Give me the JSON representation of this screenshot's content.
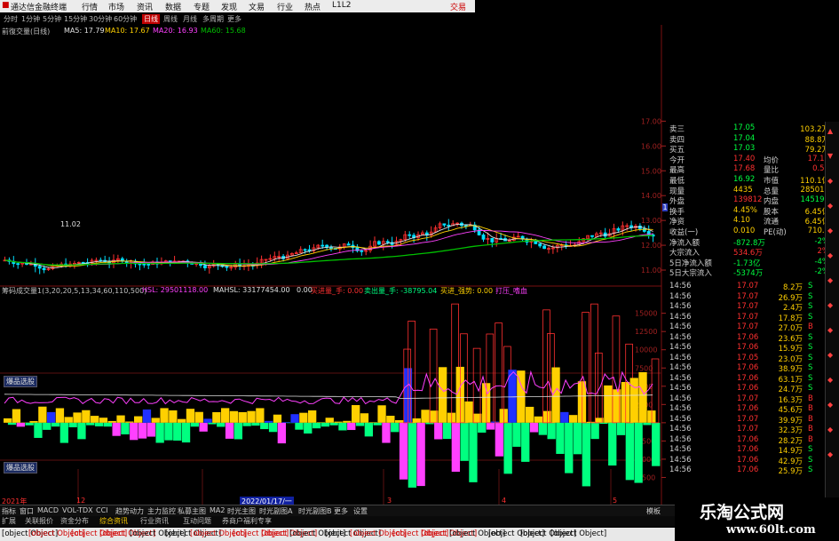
{
  "titlebar": {
    "app_title": "通达信金融终端",
    "menu": [
      "行情",
      "市场",
      "资讯",
      "数据",
      "专题",
      "发现",
      "文易",
      "行业",
      "热点",
      "L1L2"
    ],
    "trade": "交易"
  },
  "timeframes": {
    "items": [
      "分时",
      "1分钟",
      "5分钟",
      "15分钟",
      "30分钟",
      "60分钟",
      "日线",
      "周线",
      "月线",
      "多周期",
      "更多"
    ],
    "active_index": 6
  },
  "ma_legend": {
    "name": "前復交量(日线)",
    "items": [
      {
        "label": "MA5: 17.79",
        "color": "#e0e0e0"
      },
      {
        "label": "MA10: 17.67",
        "color": "#ffd000"
      },
      {
        "label": "MA20: 16.93",
        "color": "#ff40ff"
      },
      {
        "label": "MA60: 15.68",
        "color": "#00c000"
      }
    ]
  },
  "price_annotation": "11.02",
  "current_price_tag": "13.56",
  "indicator_legend": {
    "name": "筹码成交量1(3,20,20,5,13,34,60,110,500)",
    "items": [
      {
        "label": "HSL: 29501118.00",
        "color": "#ff40ff"
      },
      {
        "label": "MAHSL: 33177454.00",
        "color": "#e0e0e0"
      },
      {
        "label": "0.00",
        "color": "#e0e0e0"
      },
      {
        "label": "买进量_手: 0.00",
        "color": "#ff3030"
      },
      {
        "label": "卖出量_手: -38795.04",
        "color": "#00ff80"
      },
      {
        "label": "买进_强势: 0.00",
        "color": "#ffd000"
      },
      {
        "label": "打压_嗜血",
        "color": "#ff40ff"
      }
    ]
  },
  "side_labels": [
    "爆品选股",
    "爆品选股"
  ],
  "date_labels": [
    "2021年",
    "12",
    "2022/01/17/一",
    "3",
    "4",
    "5"
  ],
  "price_axis": {
    "ticks": [
      {
        "v": 17.0,
        "label": "17.00"
      },
      {
        "v": 16.0,
        "label": "16.00"
      },
      {
        "v": 15.0,
        "label": "15.00"
      },
      {
        "v": 14.0,
        "label": "14.00"
      },
      {
        "v": 13.0,
        "label": "13.00"
      },
      {
        "v": 12.0,
        "label": "12.00"
      },
      {
        "v": 11.0,
        "label": "11.00"
      }
    ]
  },
  "vol_axis": {
    "ticks": [
      {
        "v": 15000,
        "label": "15000"
      },
      {
        "v": 12500,
        "label": "12500"
      },
      {
        "v": 10000,
        "label": "10000"
      },
      {
        "v": 7500,
        "label": "7500"
      },
      {
        "v": 5000,
        "label": "5000"
      },
      {
        "v": 2500,
        "label": "2500"
      },
      {
        "v": 0,
        "label": "0"
      },
      {
        "v": -2500,
        "label": "-2500"
      },
      {
        "v": -5000,
        "label": "-5000"
      },
      {
        "v": -7500,
        "label": "-7500"
      }
    ]
  },
  "chart_data": {
    "type": "candlestick",
    "price_range": [
      10.5,
      17.3
    ],
    "up_color": "#ff3030",
    "down_color": "#00e0ff",
    "ma_colors": [
      "#e0e0e0",
      "#ffd000",
      "#ff40ff",
      "#00c000"
    ],
    "volume_range": [
      -10000,
      18000
    ],
    "buy_color": "#ffd000",
    "sell_color": "#00ff80",
    "strong_color": "#ff40ff",
    "blue_color": "#2030ff"
  },
  "quote": {
    "rows": [
      {
        "l": "卖三",
        "v": "17.05",
        "c": "#00ff40",
        "r": "103.2万",
        "rc": "#ffd000"
      },
      {
        "l": "卖四",
        "v": "17.04",
        "c": "#00ff40",
        "r": "88.8万",
        "rc": "#ffd000"
      },
      {
        "l": "买五",
        "v": "17.03",
        "c": "#00ff40",
        "r": "79.2万",
        "rc": "#ffd000"
      },
      {
        "l": "今开",
        "v": "17.40",
        "c": "#ff3030",
        "r2l": "均价",
        "r": "17.14",
        "rc": "#ff3030"
      },
      {
        "l": "最高",
        "v": "17.68",
        "c": "#ff3030",
        "r2l": "量比",
        "r": "0.53",
        "rc": "#ff3030"
      },
      {
        "l": "最低",
        "v": "16.92",
        "c": "#00ff40",
        "r2l": "市值",
        "r": "110.1亿",
        "rc": "#ffd000"
      },
      {
        "l": "现量",
        "v": "4435",
        "c": "#ffd000",
        "r2l": "总量",
        "r": "285011",
        "rc": "#ffd000"
      },
      {
        "l": "外盘",
        "v": "139812",
        "c": "#ff3030",
        "r2l": "内盘",
        "r": "145199",
        "rc": "#00ff40"
      },
      {
        "l": "换手",
        "v": "4.45%",
        "c": "#ffd000",
        "r2l": "股本",
        "r": "6.45亿",
        "rc": "#ffd000"
      },
      {
        "l": "净资",
        "v": "4.10",
        "c": "#ffd000",
        "r2l": "流通",
        "r": "6.45亿",
        "rc": "#ffd000"
      },
      {
        "l": "收益(一)",
        "v": "0.010",
        "c": "#ffd000",
        "r2l": "PE(动)",
        "r": "710.4",
        "rc": "#ffd000"
      },
      {
        "l": "净流入额",
        "v": "-872.8万",
        "c": "#00ff40",
        "r": "-2%",
        "rc": "#00ff40"
      },
      {
        "l": "大宗流入",
        "v": "534.6万",
        "c": "#ff3030",
        "r": "2%",
        "rc": "#ff3030"
      },
      {
        "l": "5日净流入额",
        "v": "-1.73亿",
        "c": "#00ff40",
        "r": "-4%",
        "rc": "#00ff40"
      },
      {
        "l": "5日大宗流入",
        "v": "-5374万",
        "c": "#00ff40",
        "r": "-2%",
        "rc": "#00ff40"
      }
    ],
    "ticks": [
      {
        "t": "14:56",
        "p": "17.07",
        "v": "8.2万",
        "s": "S"
      },
      {
        "t": "14:56",
        "p": "17.07",
        "v": "26.9万",
        "s": "S"
      },
      {
        "t": "14:56",
        "p": "17.07",
        "v": "2.4万",
        "s": "S"
      },
      {
        "t": "14:56",
        "p": "17.07",
        "v": "17.8万",
        "s": "S"
      },
      {
        "t": "14:56",
        "p": "17.07",
        "v": "27.0万",
        "s": "B"
      },
      {
        "t": "14:56",
        "p": "17.06",
        "v": "23.6万",
        "s": "S"
      },
      {
        "t": "14:56",
        "p": "17.06",
        "v": "15.9万",
        "s": "S"
      },
      {
        "t": "14:56",
        "p": "17.05",
        "v": "23.0万",
        "s": "S"
      },
      {
        "t": "14:56",
        "p": "17.06",
        "v": "38.9万",
        "s": "S"
      },
      {
        "t": "14:56",
        "p": "17.06",
        "v": "63.1万",
        "s": "S"
      },
      {
        "t": "14:56",
        "p": "17.06",
        "v": "24.7万",
        "s": "S"
      },
      {
        "t": "14:56",
        "p": "17.07",
        "v": "16.3万",
        "s": "B"
      },
      {
        "t": "14:56",
        "p": "17.06",
        "v": "45.6万",
        "s": "B"
      },
      {
        "t": "14:56",
        "p": "17.07",
        "v": "39.9万",
        "s": "B"
      },
      {
        "t": "14:56",
        "p": "17.07",
        "v": "32.3万",
        "s": "B"
      },
      {
        "t": "14:56",
        "p": "17.06",
        "v": "28.2万",
        "s": "B"
      },
      {
        "t": "14:56",
        "p": "17.06",
        "v": "14.9万",
        "s": "S"
      },
      {
        "t": "14:56",
        "p": "17.06",
        "v": "42.9万",
        "s": "S"
      },
      {
        "t": "14:56",
        "p": "17.06",
        "v": "25.9万",
        "s": "S"
      }
    ]
  },
  "sidebar_icons": [
    "▲",
    "▼",
    "◆",
    "◆",
    "◆",
    "◆",
    "◆",
    "◆",
    "◆",
    "◆",
    "◆",
    "◆",
    "◆",
    "◆"
  ],
  "tabs": {
    "row1": [
      "指标",
      "窗口",
      "MACD",
      "VOL-TDX",
      "CCI",
      "趋势动力",
      "主力监控",
      "私募主图",
      "MA2",
      "时光主图",
      "时光副图A",
      "时光副图B",
      "更多",
      "设置"
    ],
    "row2": [
      "扩展",
      "关联报价",
      "资金分布",
      "综合资讯",
      "行业资讯",
      "互动问题",
      "券商户福利专享"
    ],
    "right": "模板"
  },
  "statusbar": {
    "items": [
      {
        "text": "上证",
        "c": "#000"
      },
      {
        "text": "3084.28",
        "c": "#d00000"
      },
      {
        "text": "29.29",
        "c": "#d00000"
      },
      {
        "text": "0.96%",
        "c": "#d00000"
      },
      {
        "text": "3409亿",
        "c": "#000"
      },
      {
        "text": "沪深",
        "c": "#000"
      },
      {
        "text": "3988.60",
        "c": "#d00000"
      },
      {
        "text": "29.86",
        "c": "#d00000"
      },
      {
        "text": "0.75%",
        "c": "#d00000"
      },
      {
        "text": "1957亿",
        "c": "#000"
      },
      {
        "text": "创业",
        "c": "#000"
      },
      {
        "text": "2358.16",
        "c": "#d00000"
      },
      {
        "text": "6.89",
        "c": "#d00000"
      },
      {
        "text": "0.29%",
        "c": "#d00000"
      },
      {
        "text": "1338亿",
        "c": "#000"
      },
      {
        "text": "总成交",
        "c": "#000"
      },
      {
        "text": "7572亿",
        "c": "#000"
      },
      {
        "text": "平安证券上海上证云行情",
        "c": "#000"
      }
    ]
  },
  "watermark": {
    "line1": "乐淘公式网",
    "line2": "www.60lt.com"
  }
}
